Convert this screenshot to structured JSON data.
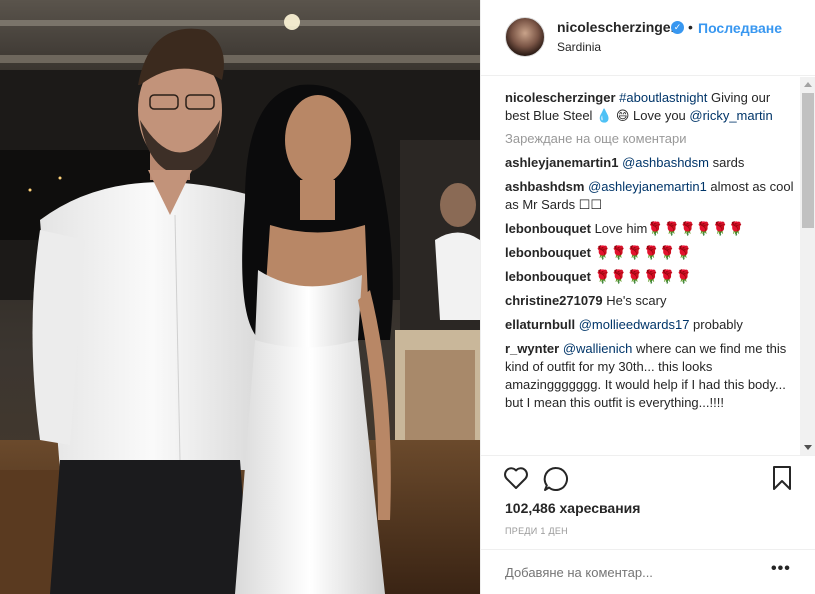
{
  "header": {
    "username": "nicolescherzinger",
    "verified_icon": "verified-badge-icon",
    "separator": "•",
    "follow_label": "Последване",
    "location": "Sardinia"
  },
  "comments": [
    {
      "user": "nicolescherzinger",
      "parts": [
        {
          "t": "tag",
          "v": "#aboutlastnight"
        },
        {
          "t": "text",
          "v": " Giving our best Blue Steel 💧 😄 Love you "
        },
        {
          "t": "tag",
          "v": "@ricky_martin"
        }
      ]
    },
    {
      "type": "load_more",
      "label": "Зареждане на още коментари"
    },
    {
      "user": "ashleyjanemartin1",
      "parts": [
        {
          "t": "tag",
          "v": "@ashbashdsm"
        },
        {
          "t": "text",
          "v": " sards"
        }
      ]
    },
    {
      "user": "ashbashdsm",
      "parts": [
        {
          "t": "tag",
          "v": "@ashleyjanemartin1"
        },
        {
          "t": "text",
          "v": " almost as cool as Mr Sards ☐☐"
        }
      ]
    },
    {
      "user": "lebonbouquet",
      "parts": [
        {
          "t": "text",
          "v": "Love him🌹🌹🌹🌹🌹🌹"
        }
      ]
    },
    {
      "user": "lebonbouquet",
      "parts": [
        {
          "t": "text",
          "v": "🌹🌹🌹🌹🌹🌹"
        }
      ]
    },
    {
      "user": "lebonbouquet",
      "parts": [
        {
          "t": "text",
          "v": "🌹🌹🌹🌹🌹🌹"
        }
      ]
    },
    {
      "user": "christine271079",
      "parts": [
        {
          "t": "text",
          "v": "He's scary"
        }
      ]
    },
    {
      "user": "ellaturnbull",
      "parts": [
        {
          "t": "tag",
          "v": "@mollieedwards17"
        },
        {
          "t": "text",
          "v": " probably"
        }
      ]
    },
    {
      "user": "r_wynter",
      "parts": [
        {
          "t": "tag",
          "v": "@wallienich"
        },
        {
          "t": "text",
          "v": " where can we find me this kind of outfit for my 30th... this looks amazinggggggg. It would help if I had this body... but I mean this outfit is everything...!!!!"
        }
      ]
    }
  ],
  "actions": {
    "like_icon": "heart-icon",
    "comment_icon": "comment-bubble-icon",
    "save_icon": "bookmark-icon",
    "likes_count": "102,486",
    "likes_word": "харесвания",
    "date": "ПРЕДИ 1 ДЕН"
  },
  "add_comment": {
    "placeholder": "Добавяне на коментар...",
    "more_label": "•••"
  },
  "colors": {
    "link": "#3897f0",
    "tag": "#003569",
    "muted": "#999999",
    "text": "#262626",
    "border": "#efefef"
  }
}
